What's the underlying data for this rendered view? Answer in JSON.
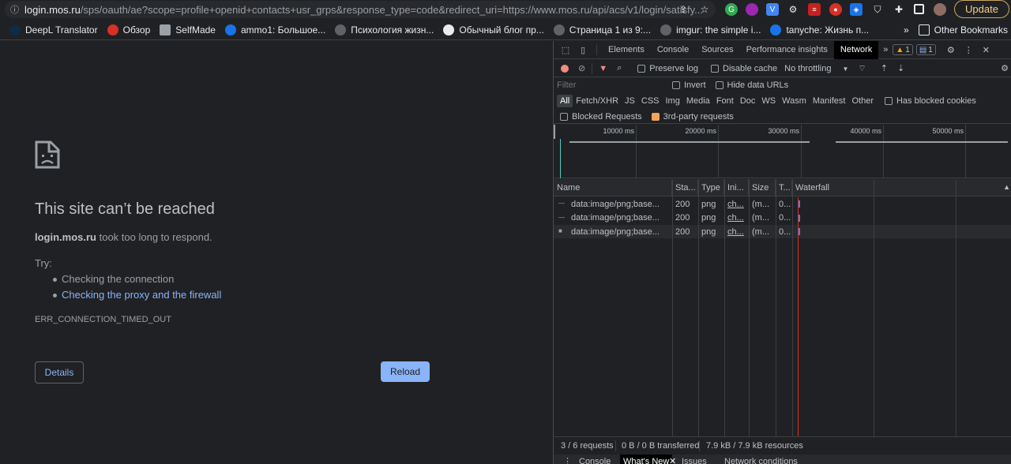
{
  "browser": {
    "url_host": "login.mos.ru",
    "url_rest": "/sps/oauth/ae?scope=profile+openid+contacts+usr_grps&response_type=code&redirect_uri=https://www.mos.ru/api/acs/v1/login/satisfy...",
    "update_label": "Update",
    "bookmarks": [
      {
        "label": "DeepL Translator",
        "icon": "deepl-icon",
        "color": "#0f2b46"
      },
      {
        "label": "Обзор",
        "icon": "obzor-icon",
        "color": "#d93025"
      },
      {
        "label": "SelfMade",
        "icon": "folder-icon",
        "color": "#9aa0a6"
      },
      {
        "label": "ammo1: Большое...",
        "icon": "ammo-icon",
        "color": "#1a73e8"
      },
      {
        "label": "Психология жизн...",
        "icon": "globe-icon",
        "color": "#5f6368"
      },
      {
        "label": "Обычный блог пр...",
        "icon": "wordpress-icon",
        "color": "#e8eaed"
      },
      {
        "label": "Страница 1 из 9:...",
        "icon": "globe-icon",
        "color": "#5f6368"
      },
      {
        "label": "imgur: the simple i...",
        "icon": "globe-icon",
        "color": "#5f6368"
      },
      {
        "label": "tanyche: Жизнь п...",
        "icon": "lj-icon",
        "color": "#1a73e8"
      }
    ],
    "bookmarks_overflow": "»",
    "other_bookmarks": "Other Bookmarks"
  },
  "error_page": {
    "title": "This site can’t be reached",
    "host": "login.mos.ru",
    "desc_suffix": " took too long to respond.",
    "try_label": "Try:",
    "suggestion_1": "Checking the connection",
    "suggestion_2": "Checking the proxy and the firewall",
    "error_code": "ERR_CONNECTION_TIMED_OUT",
    "details_label": "Details",
    "reload_label": "Reload"
  },
  "devtools": {
    "tabs": [
      "Elements",
      "Console",
      "Sources",
      "Performance insights",
      "Network"
    ],
    "active_tab": "Network",
    "warning_count": "1",
    "message_count": "1",
    "toolbar": {
      "preserve_log": "Preserve log",
      "disable_cache": "Disable cache",
      "throttling": "No throttling"
    },
    "filter": {
      "placeholder": "Filter",
      "invert": "Invert",
      "hide_data_urls": "Hide data URLs"
    },
    "types": [
      "All",
      "Fetch/XHR",
      "JS",
      "CSS",
      "Img",
      "Media",
      "Font",
      "Doc",
      "WS",
      "Wasm",
      "Manifest",
      "Other"
    ],
    "has_blocked_cookies": "Has blocked cookies",
    "blocked_requests": "Blocked Requests",
    "third_party": "3rd-party requests",
    "timeline_ticks": [
      "10000 ms",
      "20000 ms",
      "30000 ms",
      "40000 ms",
      "50000 ms"
    ],
    "columns": [
      "Name",
      "Sta...",
      "Type",
      "Ini...",
      "Size",
      "T...",
      "Waterfall"
    ],
    "rows": [
      {
        "name": "data:image/png;base...",
        "status": "200",
        "type": "png",
        "initiator": "ch...",
        "size": "(m...",
        "time": "0..."
      },
      {
        "name": "data:image/png;base...",
        "status": "200",
        "type": "png",
        "initiator": "ch...",
        "size": "(m...",
        "time": "0..."
      },
      {
        "name": "data:image/png;base...",
        "status": "200",
        "type": "png",
        "initiator": "ch...",
        "size": "(m...",
        "time": "0..."
      }
    ],
    "status": {
      "requests": "3 / 6 requests",
      "transferred": "0 B / 0 B transferred",
      "resources": "7.9 kB / 7.9 kB resources"
    },
    "drawer_tabs": [
      "Console",
      "What's New",
      "Issues",
      "Network conditions"
    ]
  }
}
